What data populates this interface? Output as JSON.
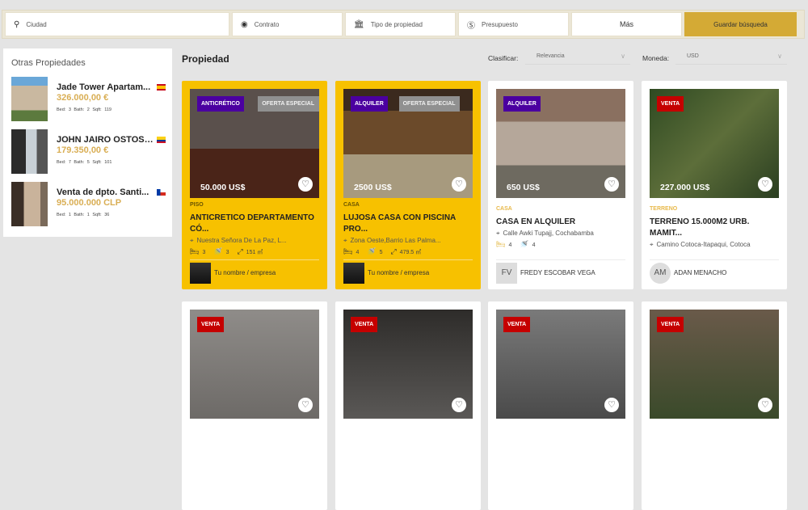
{
  "search": {
    "city_placeholder": "Ciudad",
    "contract_label": "Contrato",
    "type_label": "Tipo de propiedad",
    "budget_label": "Presupuesto",
    "more_label": "Más",
    "save_label": "Guardar búsqueda"
  },
  "sidebar": {
    "title": "Otras Propiedades",
    "items": [
      {
        "name": "Jade Tower Apartam...",
        "price": "326.000,00 €",
        "meta": "Bed: 3  Bath: 2  Sqft: 119",
        "flag": "spain"
      },
      {
        "name": "JOHN JAIRO OSTOS ...",
        "price": "179.350,00 €",
        "meta": "Bed: 7  Bath: 5  Sqft: 101",
        "flag": "colombia"
      },
      {
        "name": "Venta de dpto. Santi...",
        "price": "95.000.000 CLP",
        "meta": "Bed: 1  Bath: 1  Sqft: 36",
        "flag": "chile"
      }
    ]
  },
  "main": {
    "title": "Propiedad",
    "sort_label": "Clasificar:",
    "sort_value": "Relevancia",
    "currency_label": "Moneda:",
    "currency_value": "USD"
  },
  "colors": {
    "featured": "#f7c100",
    "accent": "#d4aa35",
    "purple": "#4b00a0",
    "red": "#c50000"
  },
  "cards": [
    {
      "featured": true,
      "badges": [
        {
          "t": "ANTICRÉTICO",
          "c": "purple"
        },
        {
          "t": "OFERTA ESPECIAL",
          "c": "gray"
        }
      ],
      "price": "50.000 US$",
      "type": "PISO",
      "title": "ANTICRETICO DEPARTAMENTO CÓ...",
      "address": "Nuestra Señora De La Paz, L...",
      "beds": "3",
      "baths": "3",
      "area": "151 ㎡",
      "agent": "Tu nombre / empresa",
      "initials": ""
    },
    {
      "featured": true,
      "badges": [
        {
          "t": "ALQUILER",
          "c": "purple"
        },
        {
          "t": "OFERTA ESPECIAL",
          "c": "gray"
        }
      ],
      "price": "2500 US$",
      "type": "CASA",
      "title": "LUJOSA CASA CON PISCINA PRO...",
      "address": "Zona Oeste,Barrio Las Palma...",
      "beds": "4",
      "baths": "5",
      "area": "479.5 ㎡",
      "agent": "Tu nombre / empresa",
      "initials": ""
    },
    {
      "featured": false,
      "badges": [
        {
          "t": "ALQUILER",
          "c": "purple"
        }
      ],
      "price": "650 US$",
      "type": "CASA",
      "title": "CASA EN ALQUILER",
      "address": "Calle Awki Tupajj, Cochabamba",
      "beds": "4",
      "baths": "4",
      "area": "",
      "agent": "FREDY ESCOBAR VEGA",
      "initials": "FV"
    },
    {
      "featured": false,
      "badges": [
        {
          "t": "VENTA",
          "c": "red"
        }
      ],
      "price": "227.000 US$",
      "type": "TERRENO",
      "title": "TERRENO 15.000M2 URB. MAMIT...",
      "address": "Camino Cotoca-Itapaqui, Cotoca",
      "beds": "",
      "baths": "",
      "area": "",
      "agent": "ADAN MENACHO",
      "initials": "AM"
    },
    {
      "featured": false,
      "badges": [
        {
          "t": "VENTA",
          "c": "red"
        }
      ]
    },
    {
      "featured": false,
      "badges": [
        {
          "t": "VENTA",
          "c": "red"
        }
      ]
    },
    {
      "featured": false,
      "badges": [
        {
          "t": "VENTA",
          "c": "red"
        }
      ]
    },
    {
      "featured": false,
      "badges": [
        {
          "t": "VENTA",
          "c": "red"
        }
      ]
    }
  ]
}
